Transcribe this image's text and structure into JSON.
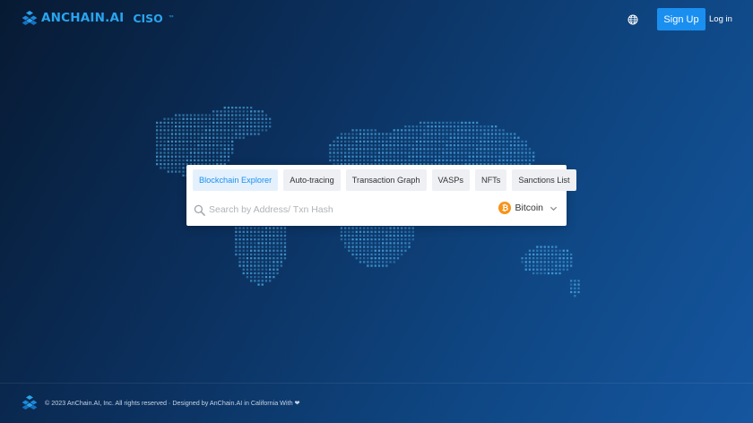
{
  "header": {
    "logo_text": "ANCHAIN.AI",
    "logo_sub": "CISO",
    "logo_tm": "™",
    "signup_label": "Sign Up",
    "login_label": "Log in",
    "language_icon": "globe-icon"
  },
  "search_panel": {
    "tabs": [
      {
        "label": "Blockchain Explorer",
        "active": true
      },
      {
        "label": "Auto-tracing",
        "active": false
      },
      {
        "label": "Transaction Graph",
        "active": false
      },
      {
        "label": "VASPs",
        "active": false
      },
      {
        "label": "NFTs",
        "active": false
      },
      {
        "label": "Sanctions List",
        "active": false
      }
    ],
    "placeholder": "Search by Address/ Txn Hash",
    "coin": {
      "label": "Bitcoin",
      "symbol": "₿",
      "color": "#f7931a"
    }
  },
  "footer": {
    "text": "© 2023 AnChain.AI, Inc. All rights reserved · Designed by AnChain.AI in California With ❤"
  },
  "colors": {
    "accent": "#1a8ff0",
    "logo": "#2aa4ee",
    "map_dot": "#4fb3ee"
  }
}
